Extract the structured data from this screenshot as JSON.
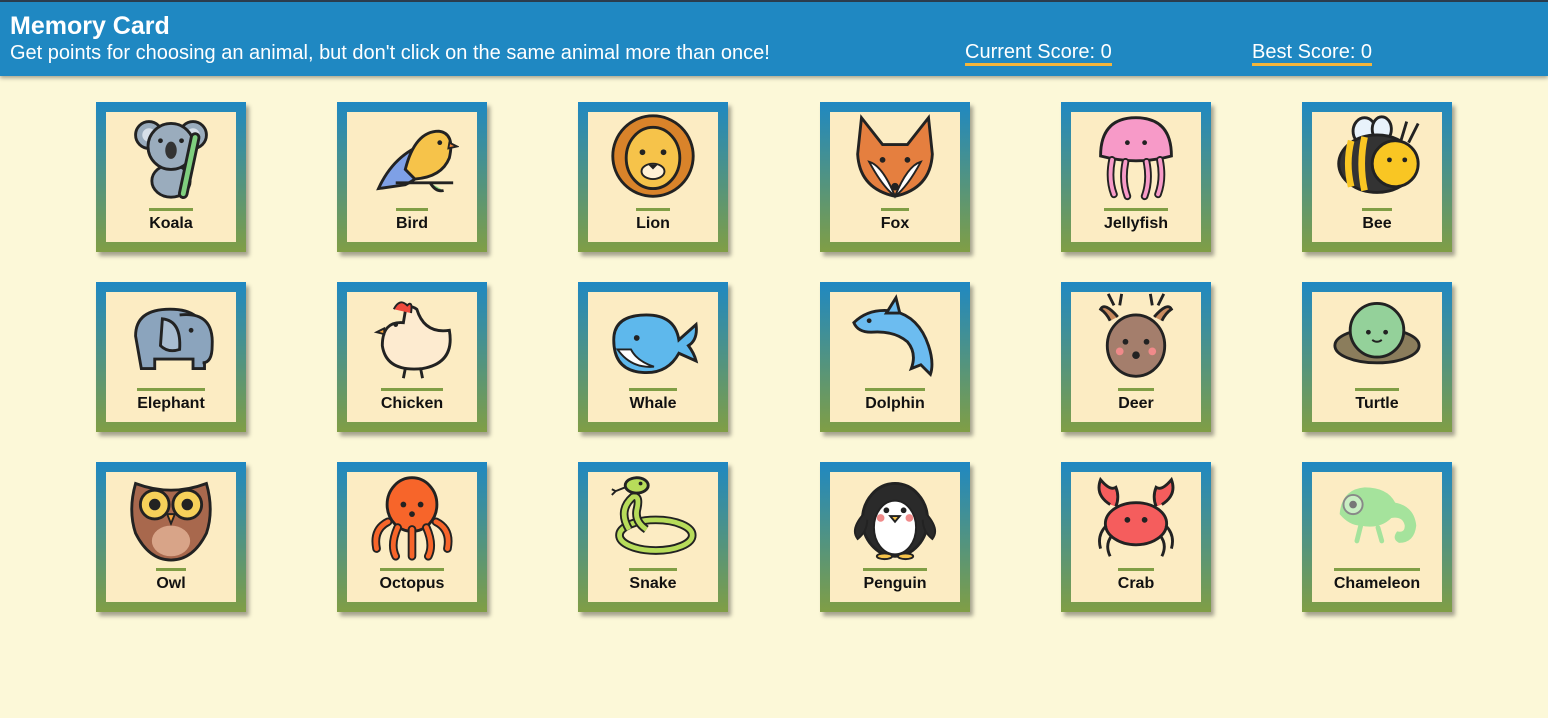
{
  "header": {
    "title": "Memory Card",
    "subtitle": "Get points for choosing an animal, but don't click on the same animal more than once!",
    "current_score_label": "Current Score: 0",
    "best_score_label": "Best Score: 0"
  },
  "colors": {
    "header_bg": "#1f88c2",
    "page_bg": "#fcf8d8",
    "card_inner_bg": "#fcecc3",
    "card_border_top": "#1f88c2",
    "card_border_bottom": "#809e45",
    "score_underline": "#f3b53a"
  },
  "cards": [
    {
      "label": "Koala",
      "icon": "koala-icon",
      "color": "#9aacbd"
    },
    {
      "label": "Bird",
      "icon": "bird-icon",
      "color": "#f6c34a"
    },
    {
      "label": "Lion",
      "icon": "lion-icon",
      "color": "#f6c34a"
    },
    {
      "label": "Fox",
      "icon": "fox-icon",
      "color": "#e57f3f"
    },
    {
      "label": "Jellyfish",
      "icon": "jellyfish-icon",
      "color": "#f79ac8"
    },
    {
      "label": "Bee",
      "icon": "bee-icon",
      "color": "#f9c623"
    },
    {
      "label": "Elephant",
      "icon": "elephant-icon",
      "color": "#8ba4bd"
    },
    {
      "label": "Chicken",
      "icon": "chicken-icon",
      "color": "#fdebd0"
    },
    {
      "label": "Whale",
      "icon": "whale-icon",
      "color": "#5eb8ec"
    },
    {
      "label": "Dolphin",
      "icon": "dolphin-icon",
      "color": "#6cbcf0"
    },
    {
      "label": "Deer",
      "icon": "deer-icon",
      "color": "#a47e6c"
    },
    {
      "label": "Turtle",
      "icon": "turtle-icon",
      "color": "#94d19a"
    },
    {
      "label": "Owl",
      "icon": "owl-icon",
      "color": "#a8684d"
    },
    {
      "label": "Octopus",
      "icon": "octopus-icon",
      "color": "#f7652a"
    },
    {
      "label": "Snake",
      "icon": "snake-icon",
      "color": "#b7dc5a"
    },
    {
      "label": "Penguin",
      "icon": "penguin-icon",
      "color": "#2a2a2a"
    },
    {
      "label": "Crab",
      "icon": "crab-icon",
      "color": "#f55d5d"
    },
    {
      "label": "Chameleon",
      "icon": "chameleon-icon",
      "color": "#a5e39c"
    }
  ]
}
